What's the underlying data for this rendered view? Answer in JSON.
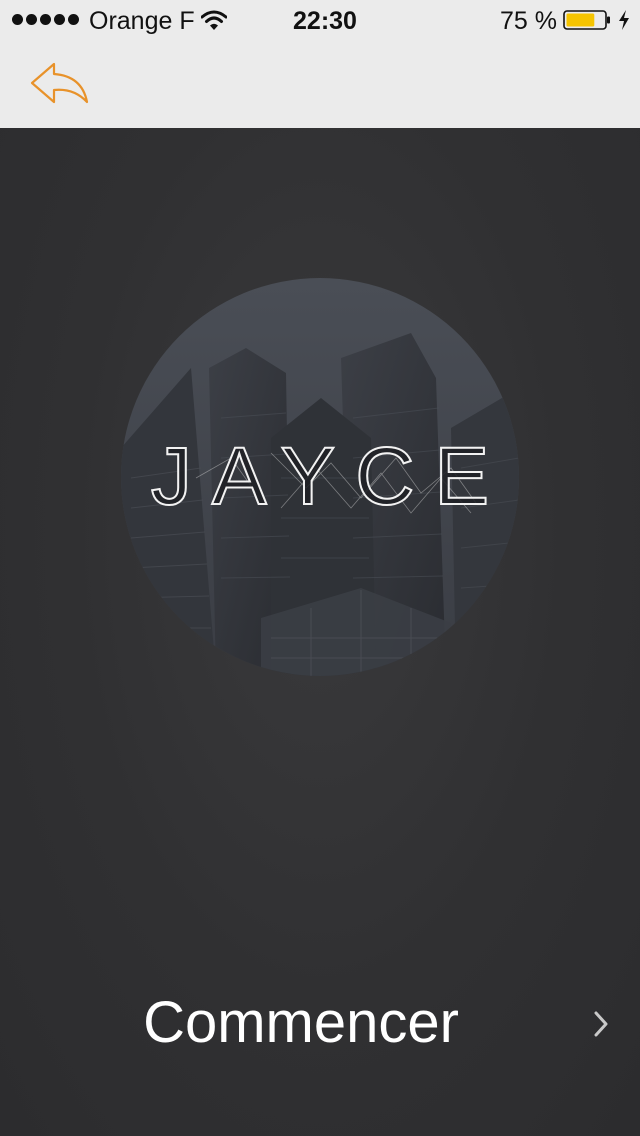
{
  "status_bar": {
    "carrier": "Orange F",
    "time": "22:30",
    "battery_percent": "75 %",
    "battery_level": 0.75,
    "signal_bars": 5,
    "icons": [
      "signal-dots",
      "wifi-icon",
      "battery-icon",
      "charging-bolt-icon"
    ]
  },
  "nav_bar": {
    "back_icon": "reply-arrow-icon"
  },
  "main": {
    "logo_text": "JAYCE",
    "start_label": "Commencer",
    "start_icon": "chevron-right-icon"
  },
  "colors": {
    "accent": "#e8922a",
    "bar_background": "#ebebeb",
    "content_background": "#2f2f31",
    "battery_fill": "#f5c400",
    "text_light": "#ffffff"
  }
}
